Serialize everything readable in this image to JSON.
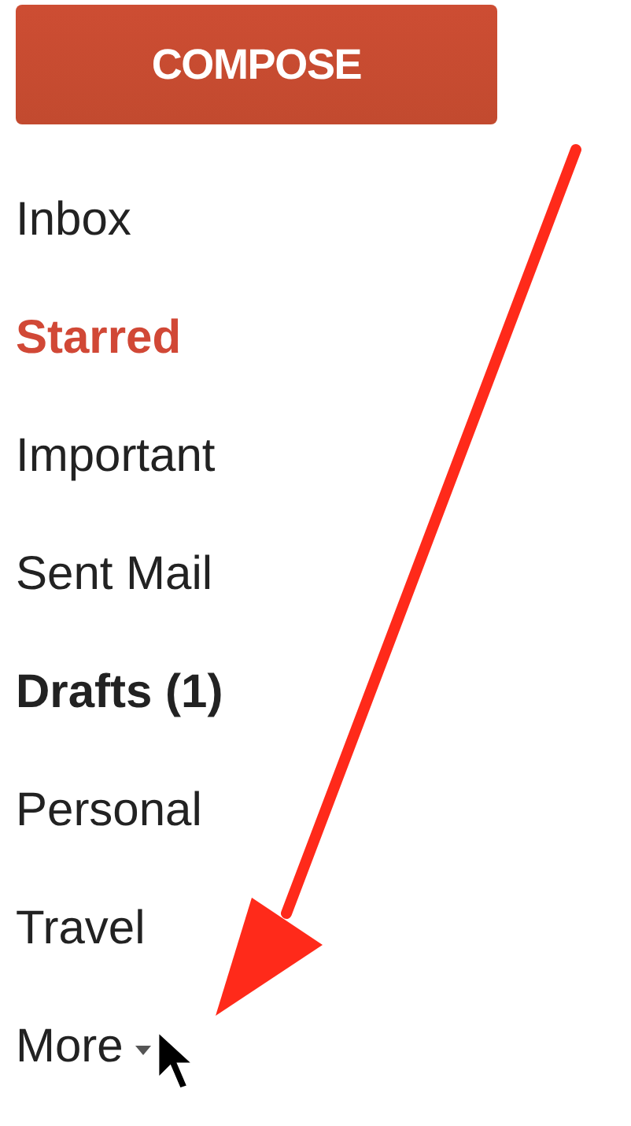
{
  "compose_button": {
    "label": "COMPOSE"
  },
  "sidebar": {
    "items": [
      {
        "label": "Inbox",
        "selected": false,
        "unread": false
      },
      {
        "label": "Starred",
        "selected": true,
        "unread": false
      },
      {
        "label": "Important",
        "selected": false,
        "unread": false
      },
      {
        "label": "Sent Mail",
        "selected": false,
        "unread": false
      },
      {
        "label": "Drafts (1)",
        "selected": false,
        "unread": true
      },
      {
        "label": "Personal",
        "selected": false,
        "unread": false
      },
      {
        "label": "Travel",
        "selected": false,
        "unread": false
      },
      {
        "label": "More",
        "selected": false,
        "unread": false,
        "kind": "more"
      }
    ]
  }
}
